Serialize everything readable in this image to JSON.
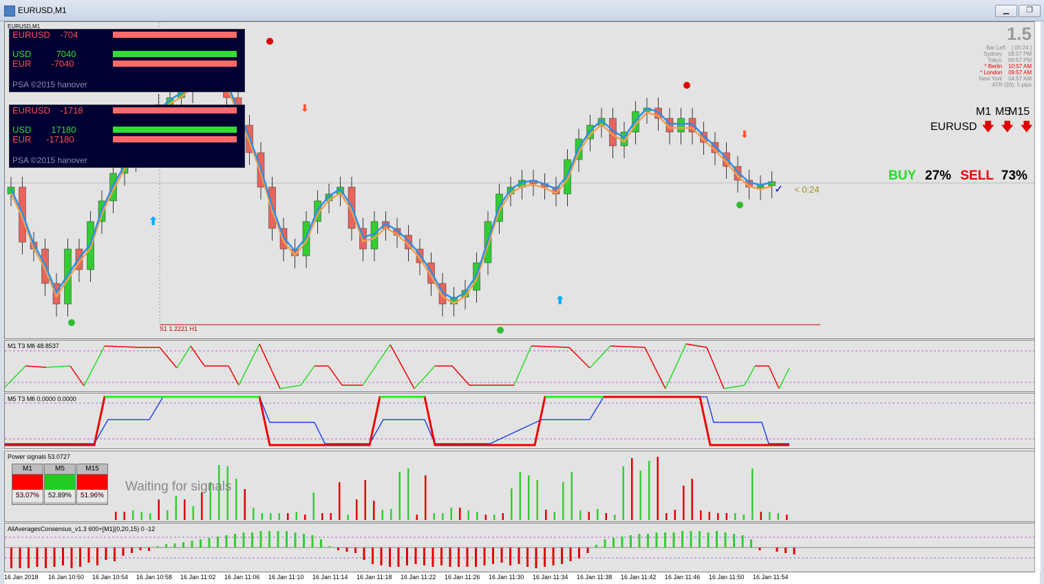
{
  "window": {
    "title": "EURUSD,M1",
    "chart_tab": "EURUSD,M1"
  },
  "strength_boxes": [
    {
      "pair": "EURUSD",
      "pair_val": "-704",
      "base": "USD",
      "base_val": "7040",
      "quote": "EUR",
      "quote_val": "-7040",
      "copyright": "PSA ©2015 hanover"
    },
    {
      "pair": "EURUSD",
      "pair_val": "-1718",
      "base": "USD",
      "base_val": "17180",
      "quote": "EUR",
      "quote_val": "-17180",
      "copyright": "PSA ©2015 hanover"
    }
  ],
  "bar_info": {
    "big": "1.5",
    "rows": [
      {
        "label": "Bar Left",
        "value": "[ 00:24 ]"
      },
      {
        "label": "Sydney",
        "value": "08:57 PM"
      },
      {
        "label": "Tokyo",
        "value": "06:57 PM"
      },
      {
        "label": "* Berlin",
        "value": "10:57 AM",
        "red": true
      },
      {
        "label": "* London",
        "value": "09:57 AM",
        "red": true
      },
      {
        "label": "New York",
        "value": "04:57 AM"
      }
    ],
    "atr": "ATR (20): 5 pips"
  },
  "timeframes": {
    "labels": [
      "M1",
      "M5",
      "M15"
    ],
    "pair": "EURUSD",
    "directions": [
      "down",
      "down",
      "down"
    ]
  },
  "consensus": {
    "buy_label": "BUY",
    "buy_pct": "27%",
    "sell_label": "SELL",
    "sell_pct": "73%"
  },
  "countdown": "< 0:24",
  "support_line": "S1 1.2221 H1",
  "panes": {
    "m1_mfi": {
      "label": "M1  T3 Mfi  48.8537",
      "scale": [
        "100",
        "90",
        "10",
        "0"
      ]
    },
    "m5_mfi": {
      "label": "M5  T3 Mfi  0.0000 0.0000",
      "scale": [
        "100",
        "90",
        "10",
        "0"
      ]
    },
    "power": {
      "label": "Power signals 53.0727",
      "waiting": "Waiting for signals",
      "scale": [
        "92",
        "48"
      ],
      "boxes": [
        {
          "tf": "M1",
          "pct": "53.07%",
          "color": "#ff0000"
        },
        {
          "tf": "M5",
          "pct": "52.89%",
          "color": "#22cc22"
        },
        {
          "tf": "M15",
          "pct": "51.96%",
          "color": "#ff0000"
        }
      ]
    },
    "consensus_osc": {
      "label": "AllAveragesConsensus_v1.3 600+[M1](0,20,15) 0 -12",
      "scale": [
        "15",
        "0",
        "-15",
        "-37"
      ]
    }
  },
  "time_axis": [
    "16 Jan 2018",
    "16 Jan 10:50",
    "16 Jan 10:54",
    "16 Jan 10:58",
    "16 Jan 11:02",
    "16 Jan 11:06",
    "16 Jan 11:10",
    "16 Jan 11:14",
    "16 Jan 11:18",
    "16 Jan 11:22",
    "16 Jan 11:26",
    "16 Jan 11:30",
    "16 Jan 11:34",
    "16 Jan 11:38",
    "16 Jan 11:42",
    "16 Jan 11:46",
    "16 Jan 11:50",
    "16 Jan 11:54"
  ],
  "colors": {
    "bull": "#33cc33",
    "bear": "#e8645c",
    "sma_fast": "#2d8fe6",
    "sma_slow": "#f0a050",
    "up_signal": "#00aaff",
    "down_signal": "#ff5533",
    "bg": "#e3e3e3"
  },
  "icons": {
    "signal_up": "arrow-up-icon",
    "signal_down": "arrow-down-icon",
    "yinyang": "yinyang-icon",
    "check": "checkmark-icon"
  }
}
